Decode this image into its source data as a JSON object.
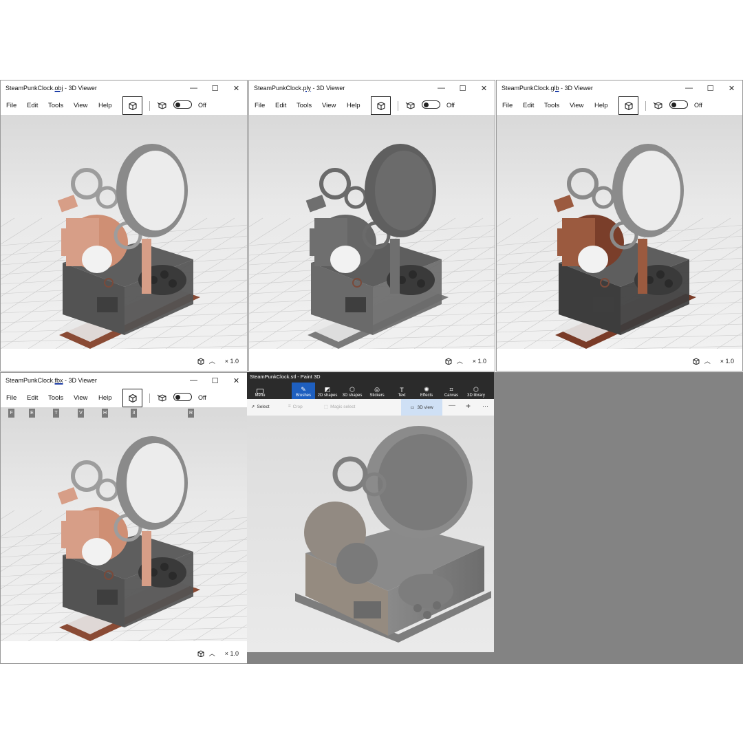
{
  "windows": [
    {
      "title_prefix": "SteamPunkClock.",
      "title_ext": "obj",
      "title_suffix": " - 3D Viewer",
      "variant": "copper"
    },
    {
      "title_prefix": "SteamPunkClock.",
      "title_ext": "ply",
      "title_suffix": " - 3D Viewer",
      "variant": "grey"
    },
    {
      "title_prefix": "SteamPunkClock.",
      "title_ext": "glb",
      "title_suffix": " - 3D Viewer",
      "variant": "copper-dark"
    },
    {
      "title_prefix": "SteamPunkClock.",
      "title_ext": "fbx",
      "title_suffix": " - 3D Viewer",
      "variant": "copper"
    }
  ],
  "menu": {
    "file": "File",
    "edit": "Edit",
    "tools": "Tools",
    "view": "View",
    "help": "Help"
  },
  "lighting_label": "Off",
  "zoom_label": "× 1.0",
  "window_controls": {
    "minimize": "—",
    "maximize": "☐",
    "close": "✕"
  },
  "keytips": {
    "file": "F",
    "edit": "E",
    "tools": "T",
    "view": "V",
    "help": "H",
    "mode": "3",
    "lighting": "R"
  },
  "paint3d": {
    "title": "SteamPunkClock.stl - Paint 3D",
    "menu": "Menu",
    "ribbon": [
      "Brushes",
      "2D shapes",
      "3D shapes",
      "Stickers",
      "Text",
      "Effects",
      "Canvas",
      "3D library"
    ],
    "tools": {
      "select": "Select",
      "crop": "Crop",
      "magic": "Magic select",
      "view3d": "3D view",
      "more": "···"
    }
  },
  "icons": {
    "mode": "cube-mode-icon",
    "lighting": "light-cube-icon",
    "status": "cube-small-icon"
  }
}
